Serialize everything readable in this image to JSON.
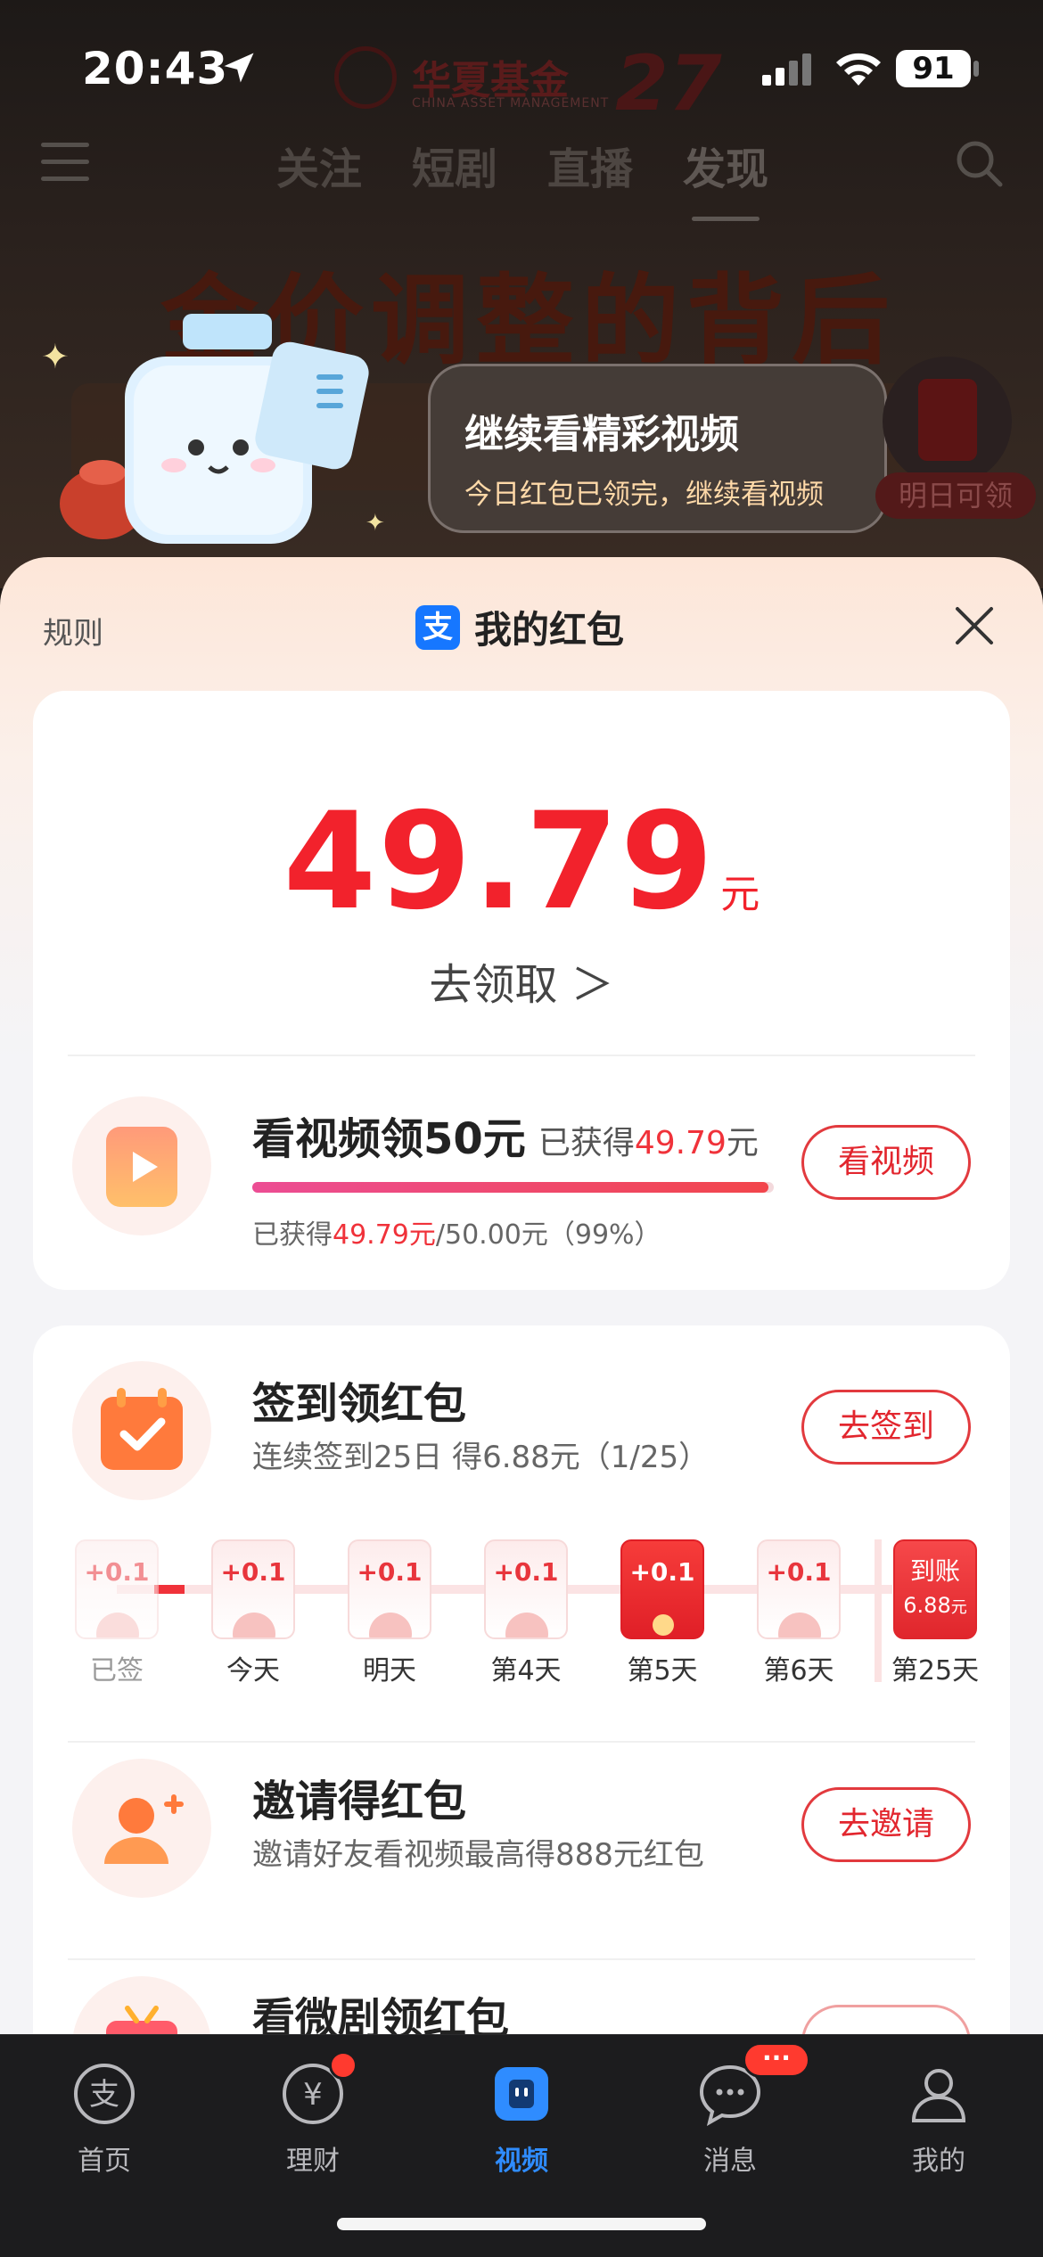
{
  "status_bar": {
    "time": "20:43",
    "battery": "91"
  },
  "video_overlay": {
    "brand_name": "华夏基金",
    "brand_sub": "CHINA ASSET MANAGEMENT",
    "brand_anniversary": "27",
    "tabs": [
      "关注",
      "短剧",
      "直播",
      "发现"
    ],
    "active_tab_index": 3,
    "headline": "金价调整的背后",
    "tooltip_title": "继续看精彩视频",
    "tooltip_subtitle": "今日红包已领完，继续看视频",
    "side_reward_label": "明日可领"
  },
  "sheet": {
    "rules_label": "规则",
    "title_badge": "支",
    "title": "我的红包",
    "balance_amount": "49.79",
    "balance_unit": "元",
    "claim_label": "去领取 ＞",
    "watch_task": {
      "title": "看视频领50元",
      "earned_prefix": "已获得",
      "earned_amount": "49.79",
      "earned_suffix": "元",
      "progress_percent": 99,
      "progress_prefix": "已获得",
      "progress_amount": "49.79元",
      "progress_suffix": "/50.00元（99%）",
      "button": "看视频"
    },
    "checkin_task": {
      "title": "签到领红包",
      "desc": "连续签到25日 得6.88元（1/25）",
      "button": "去签到",
      "days": [
        {
          "value": "+0.1",
          "label": "已签",
          "state": "done"
        },
        {
          "value": "+0.1",
          "label": "今天",
          "state": "normal"
        },
        {
          "value": "+0.1",
          "label": "明天",
          "state": "normal"
        },
        {
          "value": "+0.1",
          "label": "第4天",
          "state": "normal"
        },
        {
          "value": "+0.1",
          "label": "第5天",
          "state": "big"
        },
        {
          "value": "+0.1",
          "label": "第6天",
          "state": "normal"
        }
      ],
      "final_day": {
        "top": "到账",
        "amount": "6.88",
        "unit": "元",
        "label": "第25天"
      }
    },
    "invite_task": {
      "title": "邀请得红包",
      "desc": "邀请好友看视频最高得888元红包",
      "button": "去邀请"
    },
    "drama_task": {
      "title": "看微剧领红包"
    }
  },
  "tabbar": {
    "items": [
      {
        "label": "首页",
        "icon": "alipay-home-icon"
      },
      {
        "label": "理财",
        "icon": "wealth-icon"
      },
      {
        "label": "视频",
        "icon": "video-icon"
      },
      {
        "label": "消息",
        "icon": "message-icon"
      },
      {
        "label": "我的",
        "icon": "profile-icon"
      }
    ],
    "active_index": 2,
    "message_badge": "···"
  },
  "colors": {
    "accent_red": "#f2222c",
    "active_blue": "#2f8cff"
  }
}
